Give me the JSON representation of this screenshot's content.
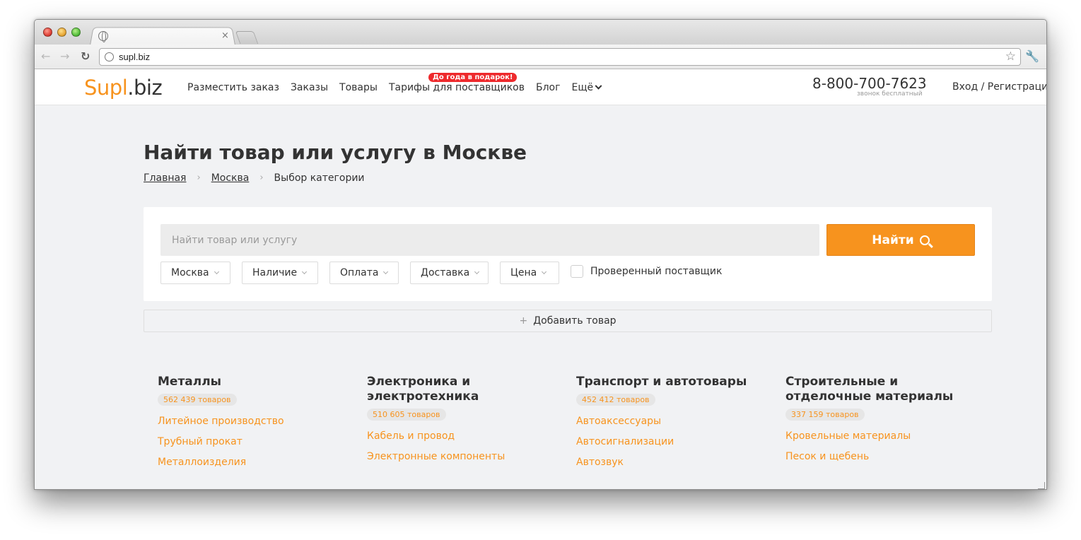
{
  "browser": {
    "url": "supl.biz",
    "tab_close": "×"
  },
  "site": {
    "logo_part1": "Supl",
    "logo_part2": ".biz",
    "menu": [
      {
        "label": "Разместить заказ"
      },
      {
        "label": "Заказы"
      },
      {
        "label": "Товары"
      },
      {
        "label": "Тарифы для поставщиков"
      },
      {
        "label": "Блог"
      },
      {
        "label": "Ещё"
      }
    ],
    "promo_badge": "До года в подарок!",
    "phone": "8-800-700-7623",
    "phone_note": "звонок бесплатный",
    "login": "Вход / Регистрация"
  },
  "page": {
    "title": "Найти товар или услугу в Москве",
    "breadcrumbs": [
      "Главная",
      "Москва",
      "Выбор категории"
    ],
    "breadcrumb_sep": "›"
  },
  "search": {
    "placeholder": "Найти товар или услугу",
    "button_label": "Найти",
    "filters": [
      "Москва",
      "Наличие",
      "Оплата",
      "Доставка",
      "Цена"
    ],
    "verified_label": "Проверенный поставщик",
    "verified_checked": false,
    "add_product": "Добавить товар",
    "add_plus": "+"
  },
  "categories": [
    {
      "title": "Металлы",
      "count": "562 439 товаров",
      "links": [
        "Литейное производство",
        "Трубный прокат",
        "Металлоизделия"
      ]
    },
    {
      "title": "Электроника и электротехника",
      "count": "510 605 товаров",
      "links": [
        "Кабель и провод",
        "Электронные компоненты"
      ]
    },
    {
      "title": "Транспорт и автотовары",
      "count": "452 412 товаров",
      "links": [
        "Автоаксессуары",
        "Автосигнализации",
        "Автозвук"
      ]
    },
    {
      "title": "Строительные и отделочные материалы",
      "count": "337 159 товаров",
      "links": [
        "Кровельные материалы",
        "Песок и щебень"
      ]
    }
  ],
  "colors": {
    "accent": "#f7931e",
    "promo": "#ee2a2d",
    "text": "#333333",
    "background": "#f1f2f4"
  }
}
